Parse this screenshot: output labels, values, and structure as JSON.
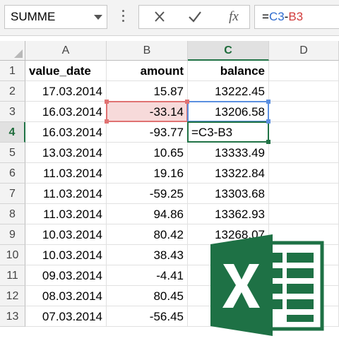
{
  "formula_bar": {
    "name_box": "SUMME",
    "fx_label": "fx",
    "formula_prefix": "=",
    "formula_ref1": "C3",
    "formula_op": "-",
    "formula_ref2": "B3"
  },
  "grid": {
    "columns": [
      "A",
      "B",
      "C",
      "D"
    ],
    "rows": [
      "1",
      "2",
      "3",
      "4",
      "5",
      "6",
      "7",
      "8",
      "9",
      "10",
      "11",
      "12",
      "13"
    ],
    "header": {
      "a": "value_date",
      "b": "amount",
      "c": "balance"
    },
    "data": [
      {
        "a": "17.03.2014",
        "b": "15.87",
        "c": "13222.45"
      },
      {
        "a": "16.03.2014",
        "b": "-33.14",
        "c": "13206.58"
      },
      {
        "a": "16.03.2014",
        "b": "-93.77",
        "c": "=C3-B3"
      },
      {
        "a": "13.03.2014",
        "b": "10.65",
        "c": "13333.49"
      },
      {
        "a": "11.03.2014",
        "b": "19.16",
        "c": "13322.84"
      },
      {
        "a": "11.03.2014",
        "b": "-59.25",
        "c": "13303.68"
      },
      {
        "a": "11.03.2014",
        "b": "94.86",
        "c": "13362.93"
      },
      {
        "a": "10.03.2014",
        "b": "80.42",
        "c": "13268.07"
      },
      {
        "a": "10.03.2014",
        "b": "38.43",
        "c": ""
      },
      {
        "a": "09.03.2014",
        "b": "-4.41",
        "c": ""
      },
      {
        "a": "08.03.2014",
        "b": "80.45",
        "c": ""
      },
      {
        "a": "07.03.2014",
        "b": "-56.45",
        "c": ""
      }
    ]
  },
  "colors": {
    "excel_green": "#217346",
    "ref_blue": "#2f6ccf",
    "ref_red": "#d23b3b"
  },
  "icons": [
    "cancel-icon",
    "enter-check-icon",
    "insert-function-icon",
    "excel-logo-icon"
  ]
}
